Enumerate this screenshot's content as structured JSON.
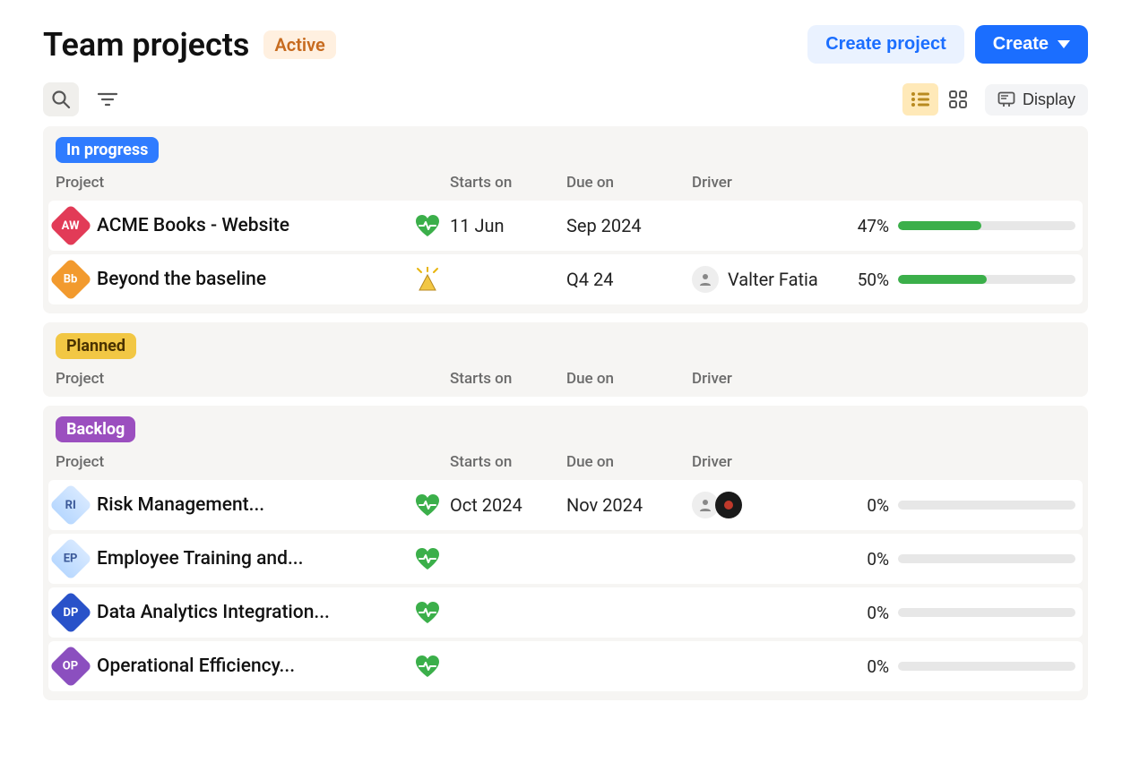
{
  "header": {
    "title": "Team projects",
    "status": "Active",
    "create_project_label": "Create project",
    "create_label": "Create"
  },
  "toolbar": {
    "display_label": "Display"
  },
  "columns": {
    "project": "Project",
    "starts_on": "Starts on",
    "due_on": "Due on",
    "driver": "Driver"
  },
  "sections": [
    {
      "key": "in_progress",
      "label": "In progress",
      "pill_class": "pill-inprogress",
      "rows": [
        {
          "icon_text": "AW",
          "icon_color": "#E23B57",
          "icon_light": false,
          "name": "ACME Books - Website",
          "health": "healthy",
          "starts_on": "11 Jun",
          "due_on": "Sep 2024",
          "driver_name": "",
          "driver_avatars": [],
          "percent": 47
        },
        {
          "icon_text": "Bb",
          "icon_color": "#F29A2E",
          "icon_light": false,
          "name": "Beyond the baseline",
          "health": "warning",
          "starts_on": "",
          "due_on": "Q4 24",
          "driver_name": "Valter Fatia",
          "driver_avatars": [
            "vf"
          ],
          "percent": 50
        }
      ]
    },
    {
      "key": "planned",
      "label": "Planned",
      "pill_class": "pill-planned",
      "rows": []
    },
    {
      "key": "backlog",
      "label": "Backlog",
      "pill_class": "pill-backlog",
      "rows": [
        {
          "icon_text": "RI",
          "icon_color": "",
          "icon_light": true,
          "name": "Risk Management...",
          "health": "healthy",
          "starts_on": "Oct 2024",
          "due_on": "Nov 2024",
          "driver_name": "",
          "driver_avatars": [
            "a",
            "b"
          ],
          "percent": 0
        },
        {
          "icon_text": "EP",
          "icon_color": "",
          "icon_light": true,
          "name": "Employee Training and...",
          "health": "healthy",
          "starts_on": "",
          "due_on": "",
          "driver_name": "",
          "driver_avatars": [],
          "percent": 0
        },
        {
          "icon_text": "DP",
          "icon_color": "#2952C9",
          "icon_light": false,
          "name": "Data Analytics Integration...",
          "health": "healthy",
          "starts_on": "",
          "due_on": "",
          "driver_name": "",
          "driver_avatars": [],
          "percent": 0
        },
        {
          "icon_text": "OP",
          "icon_color": "#8B4FBF",
          "icon_light": false,
          "name": "Operational Efficiency...",
          "health": "healthy",
          "starts_on": "",
          "due_on": "",
          "driver_name": "",
          "driver_avatars": [],
          "percent": 0
        }
      ]
    }
  ]
}
